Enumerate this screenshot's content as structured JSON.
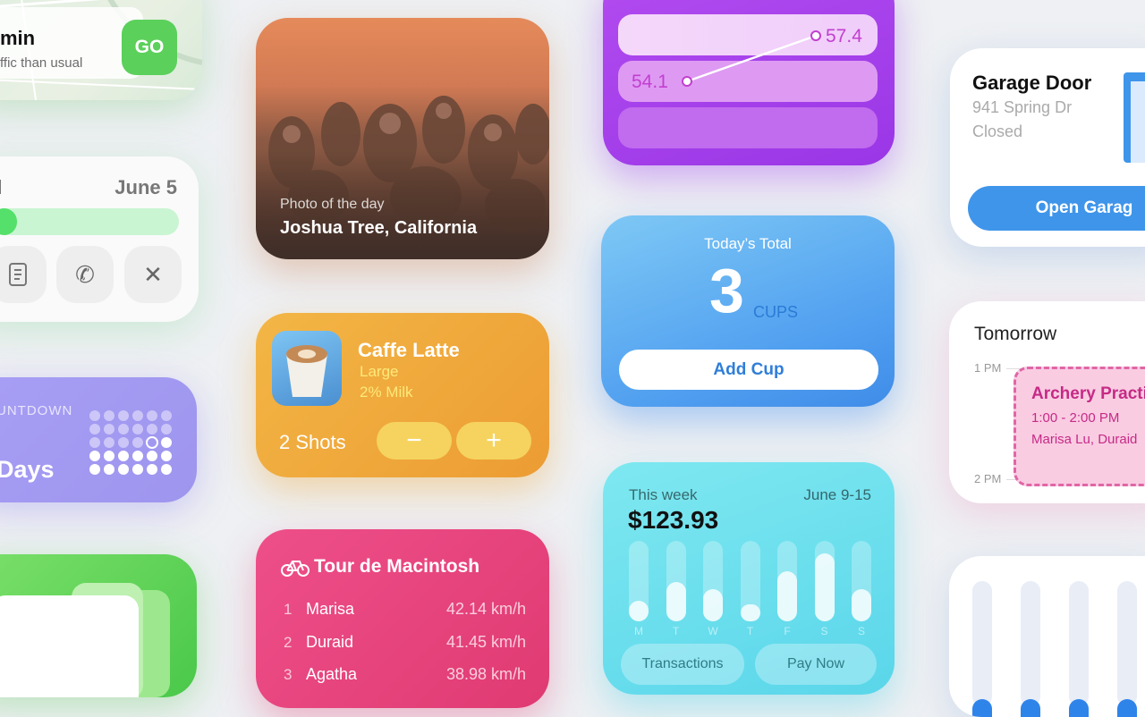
{
  "maps": {
    "eta": "min",
    "traffic": "ffic than usual",
    "go": "GO"
  },
  "delivery": {
    "label": "l",
    "date": "June 5",
    "progress_percent": 14,
    "actions": [
      "receipt-icon",
      "phone-icon",
      "close-icon"
    ]
  },
  "countdown": {
    "caption": "UNTDOWN",
    "value": "Days"
  },
  "photo": {
    "caption": "Photo of the day",
    "location": "Joshua Tree, California"
  },
  "coffee": {
    "name": "Caffe Latte",
    "size": "Large",
    "milk": "2% Milk",
    "shots": "2 Shots",
    "minus": "−",
    "plus": "+"
  },
  "tour": {
    "title": "Tour de Macintosh",
    "riders": [
      {
        "rank": "1",
        "name": "Marisa",
        "speed": "42.14 km/h"
      },
      {
        "rank": "2",
        "name": "Duraid",
        "speed": "41.45 km/h"
      },
      {
        "rank": "3",
        "name": "Agatha",
        "speed": "38.98 km/h"
      }
    ]
  },
  "stock": {
    "low": "54.1",
    "high": "57.4"
  },
  "water": {
    "title": "Today’s Total",
    "count": "3",
    "unit": "CUPS",
    "button": "Add Cup"
  },
  "spending": {
    "label": "This week",
    "range": "June  9-15",
    "amount": "$123.93",
    "days": [
      "M",
      "T",
      "W",
      "T",
      "F",
      "S",
      "S"
    ],
    "values": [
      0.26,
      0.49,
      0.4,
      0.21,
      0.62,
      0.84,
      0.4
    ],
    "actions": [
      "Transactions",
      "Pay Now"
    ]
  },
  "garage": {
    "name": "Garage Door",
    "address": "941 Spring Dr",
    "status": "Closed",
    "button": "Open Garag"
  },
  "calendar": {
    "day": "Tomorrow",
    "time1": "1 PM",
    "time2": "2 PM",
    "event": {
      "title": "Archery Practi",
      "hours": "1:00 - 2:00 PM",
      "people": "Marisa Lu, Duraid"
    }
  },
  "bars": {
    "values": [
      0.3,
      0.3,
      0.3,
      0.3
    ]
  },
  "colors": {
    "background": "#eef0f3",
    "coffee": "#ef9f35",
    "tour": "#e43f77",
    "stock": "#a63ceb",
    "water": "#4f9ef0",
    "spending": "#66dbec",
    "accent_blue": "#2f84ea"
  }
}
